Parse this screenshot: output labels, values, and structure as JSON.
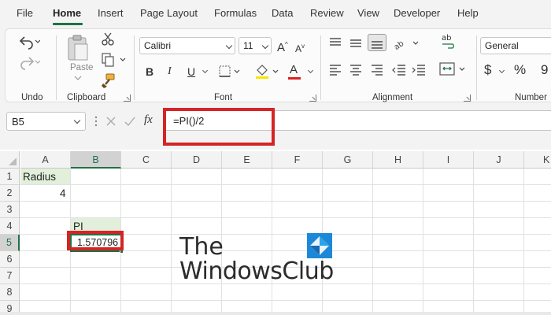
{
  "menu": {
    "tabs": [
      "File",
      "Home",
      "Insert",
      "Page Layout",
      "Formulas",
      "Data",
      "Review",
      "View",
      "Developer",
      "Help"
    ],
    "active": "Home"
  },
  "ribbon": {
    "groups": {
      "undo": "Undo",
      "clipboard": "Clipboard",
      "font": "Font",
      "alignment": "Alignment",
      "number": "Number"
    },
    "paste_label": "Paste",
    "font_name": "Calibri",
    "font_size": "11",
    "number_format": "General",
    "buttons": {
      "bold": "B",
      "italic": "I",
      "underline": "U",
      "grow_font": "A",
      "shrink_font": "A",
      "font_color": "A",
      "currency": "$",
      "percent": "%",
      "comma": "9",
      "wrap_text": "ab"
    },
    "font_color_accent": "#e02020",
    "fill_color_accent": "#f7e600"
  },
  "formula_bar": {
    "name_box": "B5",
    "fx": "fx",
    "formula": "=PI()/2"
  },
  "grid": {
    "columns": [
      "A",
      "B",
      "C",
      "D",
      "E",
      "F",
      "G",
      "H",
      "I",
      "J",
      "K"
    ],
    "rows": [
      "1",
      "2",
      "3",
      "4",
      "5",
      "6",
      "7",
      "8",
      "9"
    ],
    "selected_column": "B",
    "selected_row": "5",
    "cells": {
      "A1": "Radius",
      "A2": "4",
      "B4": "PI",
      "B5": "1.570796"
    }
  },
  "watermark": {
    "line1": "The",
    "line2": "WindowsClub"
  },
  "colors": {
    "excel_green": "#1e7145",
    "highlight_red": "#d42426",
    "cell_fill": "#e2efda"
  }
}
